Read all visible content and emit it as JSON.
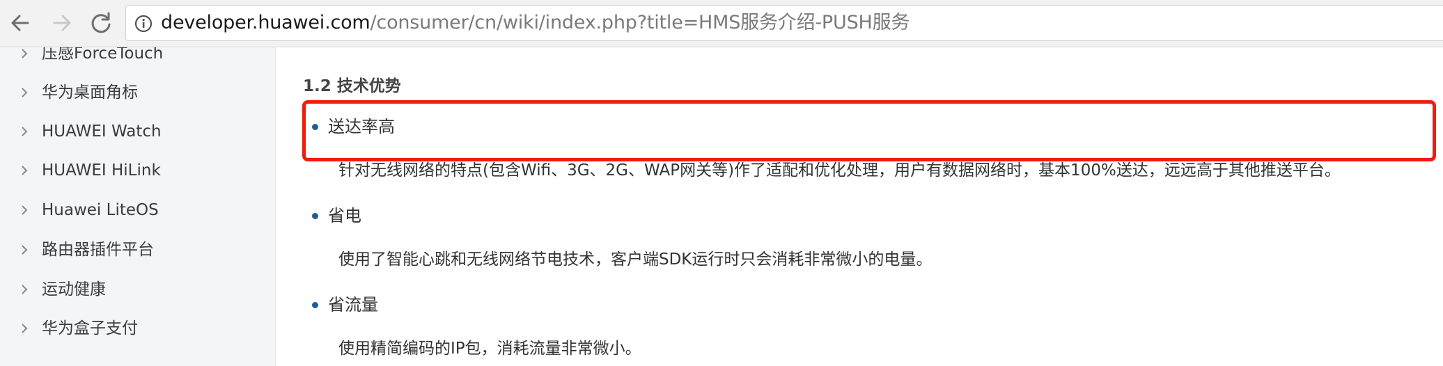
{
  "browser": {
    "url_host": "developer.huawei.com",
    "url_path": "/consumer/cn/wiki/index.php?title=HMS服务介绍-PUSH服务"
  },
  "sidebar": {
    "items": [
      {
        "label": "压感ForceTouch"
      },
      {
        "label": "华为桌面角标"
      },
      {
        "label": "HUAWEI Watch"
      },
      {
        "label": "HUAWEI HiLink"
      },
      {
        "label": "Huawei LiteOS"
      },
      {
        "label": "路由器插件平台"
      },
      {
        "label": "运动健康"
      },
      {
        "label": "华为盒子支付"
      }
    ]
  },
  "content": {
    "heading": "1.2 技术优势",
    "bullets": [
      {
        "title": "送达率高",
        "description": "针对无线网络的特点(包含Wifi、3G、2G、WAP网关等)作了适配和优化处理，用户有数据网络时，基本100%送达，远远高于其他推送平台。"
      },
      {
        "title": "省电",
        "description": "使用了智能心跳和无线网络节电技术，客户端SDK运行时只会消耗非常微小的电量。"
      },
      {
        "title": "省流量",
        "description": "使用精简编码的IP包，消耗流量非常微小。"
      }
    ]
  },
  "colors": {
    "highlight_border": "#f01c0c",
    "bullet": "#1f5d99",
    "sidebar_bg": "#f4f5f7"
  }
}
